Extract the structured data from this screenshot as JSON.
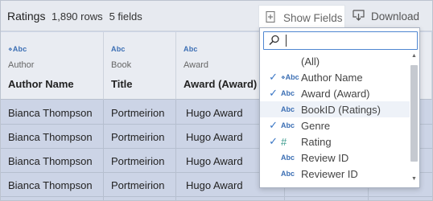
{
  "header": {
    "title": "Ratings",
    "row_count": "1,890 rows",
    "field_count": "5 fields",
    "show_fields_label": "Show Fields",
    "download_label": "Download"
  },
  "columns": [
    {
      "type": "⋄Abc",
      "source": "Author",
      "name": "Author Name"
    },
    {
      "type": "Abc",
      "source": "Book",
      "name": "Title"
    },
    {
      "type": "Abc",
      "source": "Award",
      "name": "Award (Award)"
    }
  ],
  "rows": [
    [
      "Bianca Thompson",
      "Portmeirion",
      "Hugo Award"
    ],
    [
      "Bianca Thompson",
      "Portmeirion",
      "Hugo Award"
    ],
    [
      "Bianca Thompson",
      "Portmeirion",
      "Hugo Award"
    ],
    [
      "Bianca Thompson",
      "Portmeirion",
      "Hugo Award"
    ]
  ],
  "dropdown": {
    "search_value": "",
    "items": [
      {
        "label": "(All)",
        "type": "",
        "checked": false
      },
      {
        "label": "Author Name",
        "type": "⋄Abc",
        "checked": true
      },
      {
        "label": "Award (Award)",
        "type": "Abc",
        "checked": true
      },
      {
        "label": "BookID (Ratings)",
        "type": "Abc",
        "checked": false
      },
      {
        "label": "Genre",
        "type": "Abc",
        "checked": true
      },
      {
        "label": "Rating",
        "type": "#",
        "checked": true
      },
      {
        "label": "Review ID",
        "type": "Abc",
        "checked": false
      },
      {
        "label": "Reviewer ID",
        "type": "Abc",
        "checked": false
      }
    ],
    "check_glyph": "✓"
  },
  "colors": {
    "accent": "#3c6fb4",
    "header_bg": "#e7eaf0",
    "row_bg": "#ccd4e6"
  }
}
